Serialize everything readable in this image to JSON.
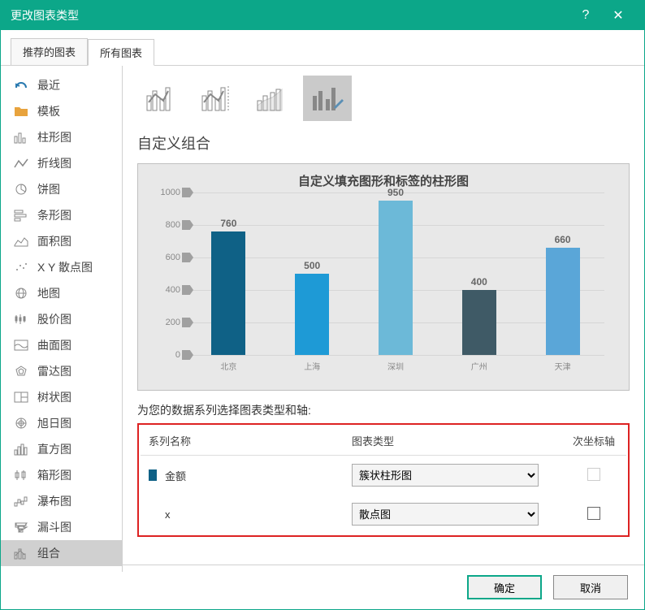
{
  "titlebar": {
    "title": "更改图表类型",
    "help": "?",
    "close": "✕"
  },
  "tabs": {
    "rec": "推荐的图表",
    "all": "所有图表"
  },
  "sidebar": {
    "items": [
      {
        "label": "最近"
      },
      {
        "label": "模板"
      },
      {
        "label": "柱形图"
      },
      {
        "label": "折线图"
      },
      {
        "label": "饼图"
      },
      {
        "label": "条形图"
      },
      {
        "label": "面积图"
      },
      {
        "label": "X Y 散点图"
      },
      {
        "label": "地图"
      },
      {
        "label": "股价图"
      },
      {
        "label": "曲面图"
      },
      {
        "label": "雷达图"
      },
      {
        "label": "树状图"
      },
      {
        "label": "旭日图"
      },
      {
        "label": "直方图"
      },
      {
        "label": "箱形图"
      },
      {
        "label": "瀑布图"
      },
      {
        "label": "漏斗图"
      },
      {
        "label": "组合"
      }
    ]
  },
  "main": {
    "section_title": "自定义组合",
    "series_label": "为您的数据系列选择图表类型和轴:",
    "headers": {
      "name": "系列名称",
      "type": "图表类型",
      "secondary": "次坐标轴"
    },
    "series": [
      {
        "name": "金额",
        "type": "簇状柱形图",
        "color": "#0f6186"
      },
      {
        "name": "x",
        "type": "散点图",
        "color": "transparent"
      }
    ]
  },
  "footer": {
    "ok": "确定",
    "cancel": "取消"
  },
  "chart_data": {
    "type": "bar",
    "title": "自定义填充图形和标签的柱形图",
    "categories": [
      "北京",
      "上海",
      "深圳",
      "广州",
      "天津"
    ],
    "values": [
      760,
      500,
      950,
      400,
      660
    ],
    "colors": [
      "#0f6186",
      "#1e9ad6",
      "#6cb9d8",
      "#3f5a66",
      "#5aa6d8"
    ],
    "ylim": [
      0,
      1000
    ],
    "yticks": [
      0,
      200,
      400,
      600,
      800,
      1000
    ]
  }
}
